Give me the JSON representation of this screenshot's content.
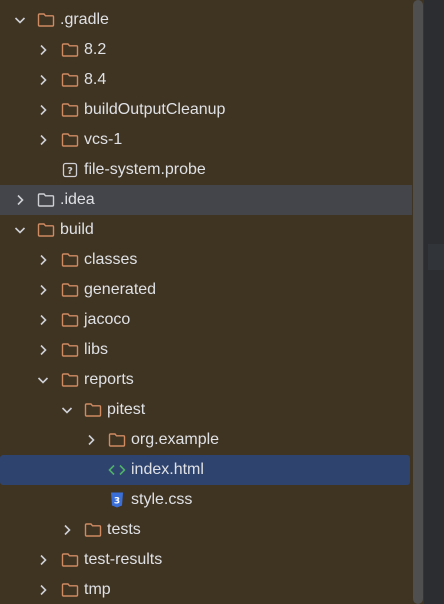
{
  "tree": {
    "gradle_folder": ".gradle",
    "gradle_children": [
      "8.2",
      "8.4",
      "buildOutputCleanup",
      "vcs-1"
    ],
    "file_system_probe": "file-system.probe",
    "idea_folder": ".idea",
    "build_folder": "build",
    "build_children_top": [
      "classes",
      "generated",
      "jacoco",
      "libs"
    ],
    "reports_folder": "reports",
    "pitest_folder": "pitest",
    "org_example_folder": "org.example",
    "index_html": "index.html",
    "style_css": "style.css",
    "tests_folder": "tests",
    "build_children_bottom": [
      "test-results",
      "tmp"
    ]
  },
  "colors": {
    "panel_bg": "#3f3322",
    "hover_row": "#43454a",
    "selected_row": "#2e436e",
    "text": "#dfe1e5",
    "folder_stroke": "#d08b62",
    "html_icon": "#4fb06a",
    "css_icon": "#3a6fd8"
  },
  "icons": {
    "expanded": "chevron-down-icon",
    "collapsed": "chevron-right-icon",
    "folder": "folder-icon",
    "unknown_file": "unknown-file-icon",
    "html_file": "html-file-icon",
    "css_file": "css-file-icon"
  }
}
